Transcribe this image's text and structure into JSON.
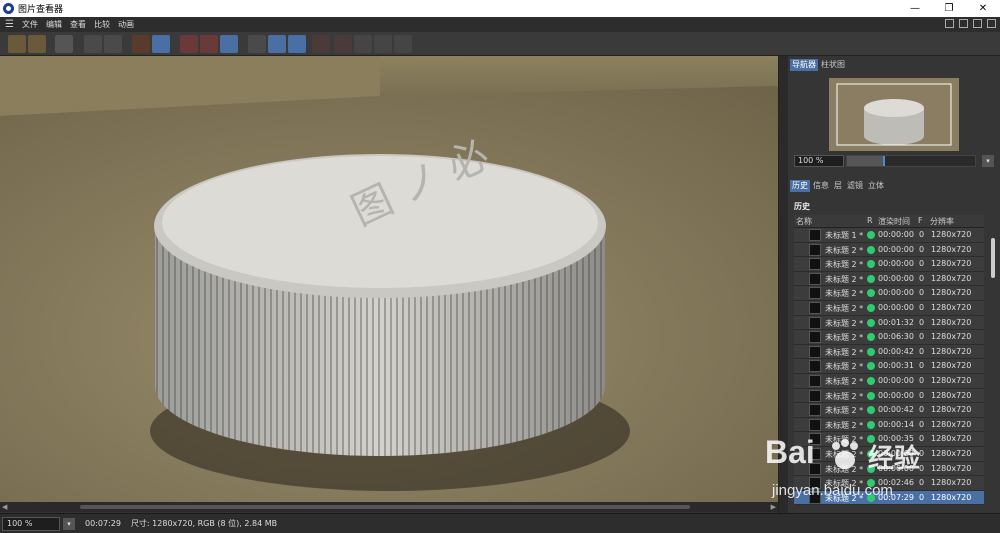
{
  "window": {
    "title": "图片查看器",
    "minimize": "—",
    "restore": "❐",
    "close": "✕"
  },
  "menu": {
    "items": [
      "文件",
      "编辑",
      "查看",
      "比较",
      "动画"
    ]
  },
  "status": {
    "zoom": "100 %",
    "render_time": "00:07:29",
    "size_info": "尺寸: 1280x720, RGB (8 位), 2.84 MB"
  },
  "scrollbar": {
    "left_arrow": "◀",
    "right_arrow": "▶"
  },
  "navigator": {
    "tabs": [
      "导航器",
      "柱状图"
    ],
    "active_tab": "导航器",
    "zoom": "100 %",
    "zoom_level": 0.28
  },
  "panel_tabs": {
    "items": [
      "历史",
      "信息",
      "层",
      "滤镜",
      "立体"
    ],
    "active": "历史"
  },
  "history": {
    "title": "历史",
    "columns": {
      "name": "名称",
      "r": "R",
      "time": "渲染时间",
      "f": "F",
      "res": "分辨率"
    },
    "rows": [
      {
        "name": "未标题 1 *",
        "time": "00:00:00",
        "f": "0",
        "res": "1280x720"
      },
      {
        "name": "未标题 2 *",
        "time": "00:00:00",
        "f": "0",
        "res": "1280x720"
      },
      {
        "name": "未标题 2 *",
        "time": "00:00:00",
        "f": "0",
        "res": "1280x720"
      },
      {
        "name": "未标题 2 *",
        "time": "00:00:00",
        "f": "0",
        "res": "1280x720"
      },
      {
        "name": "未标题 2 *",
        "time": "00:00:00",
        "f": "0",
        "res": "1280x720"
      },
      {
        "name": "未标题 2 *",
        "time": "00:00:00",
        "f": "0",
        "res": "1280x720"
      },
      {
        "name": "未标题 2 *",
        "time": "00:01:32",
        "f": "0",
        "res": "1280x720"
      },
      {
        "name": "未标题 2 *",
        "time": "00:06:30",
        "f": "0",
        "res": "1280x720"
      },
      {
        "name": "未标题 2 *",
        "time": "00:00:42",
        "f": "0",
        "res": "1280x720"
      },
      {
        "name": "未标题 2 *",
        "time": "00:00:31",
        "f": "0",
        "res": "1280x720"
      },
      {
        "name": "未标题 2 *",
        "time": "00:00:00",
        "f": "0",
        "res": "1280x720"
      },
      {
        "name": "未标题 2 *",
        "time": "00:00:00",
        "f": "0",
        "res": "1280x720"
      },
      {
        "name": "未标题 2 *",
        "time": "00:00:42",
        "f": "0",
        "res": "1280x720"
      },
      {
        "name": "未标题 2 *",
        "time": "00:00:14",
        "f": "0",
        "res": "1280x720"
      },
      {
        "name": "未标题 2 *",
        "time": "00:00:35",
        "f": "0",
        "res": "1280x720"
      },
      {
        "name": "未标题 2 *",
        "time": "00:00:00",
        "f": "0",
        "res": "1280x720"
      },
      {
        "name": "未标题 2 *",
        "time": "00:00:00",
        "f": "0",
        "res": "1280x720"
      },
      {
        "name": "未标题 2 *",
        "time": "00:02:46",
        "f": "0",
        "res": "1280x720"
      },
      {
        "name": "未标题 2 *",
        "time": "00:07:29",
        "f": "0",
        "res": "1280x720"
      }
    ]
  },
  "watermark": {
    "brand": "Bai",
    "brand2": "经验",
    "url": "jingyan.baidu.com"
  },
  "colors": {
    "accent": "#4a6fa5",
    "render_ok": "#2ecc71",
    "floor": "#8a7d62"
  }
}
